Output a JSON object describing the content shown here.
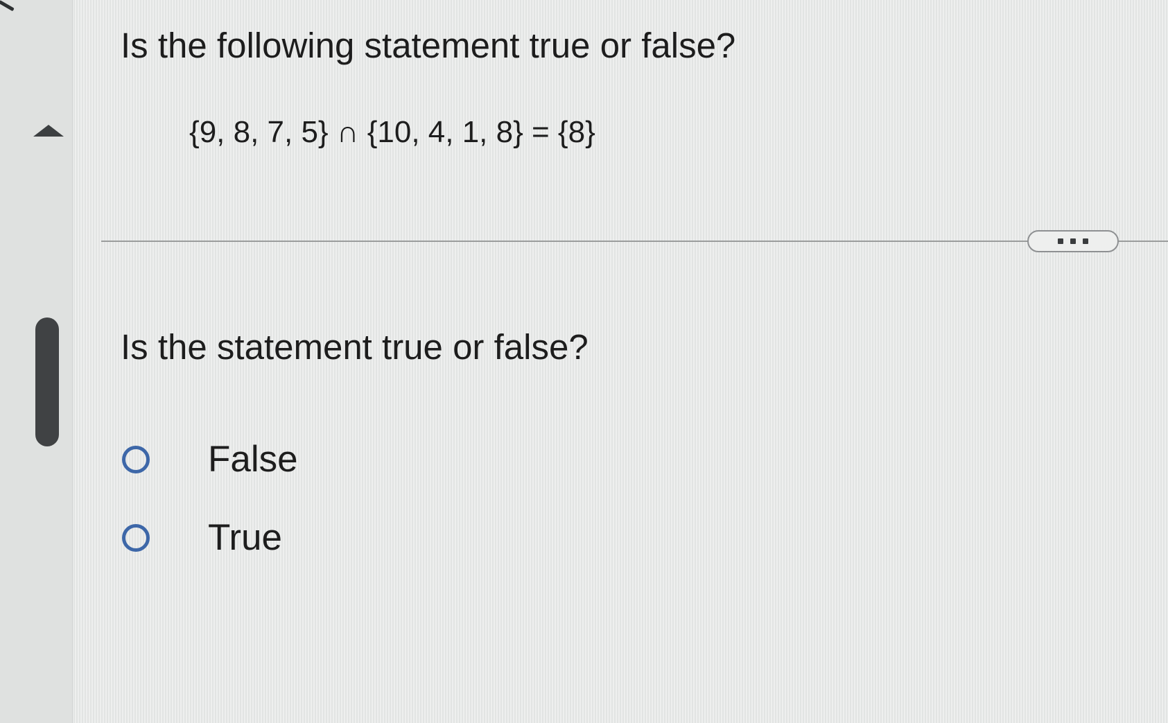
{
  "question": {
    "title": "Is the following statement true or false?",
    "statement": "{9, 8, 7, 5} ∩ {10, 4, 1, 8} = {8}"
  },
  "more_button": {
    "icon": "more-dots-icon"
  },
  "answer": {
    "prompt": "Is the statement true or false?",
    "options": [
      {
        "label": "False",
        "selected": false
      },
      {
        "label": "True",
        "selected": false
      }
    ]
  },
  "colors": {
    "radio_border": "#3d67a8",
    "background": "#e9ebea",
    "text": "#1d1d1d"
  }
}
